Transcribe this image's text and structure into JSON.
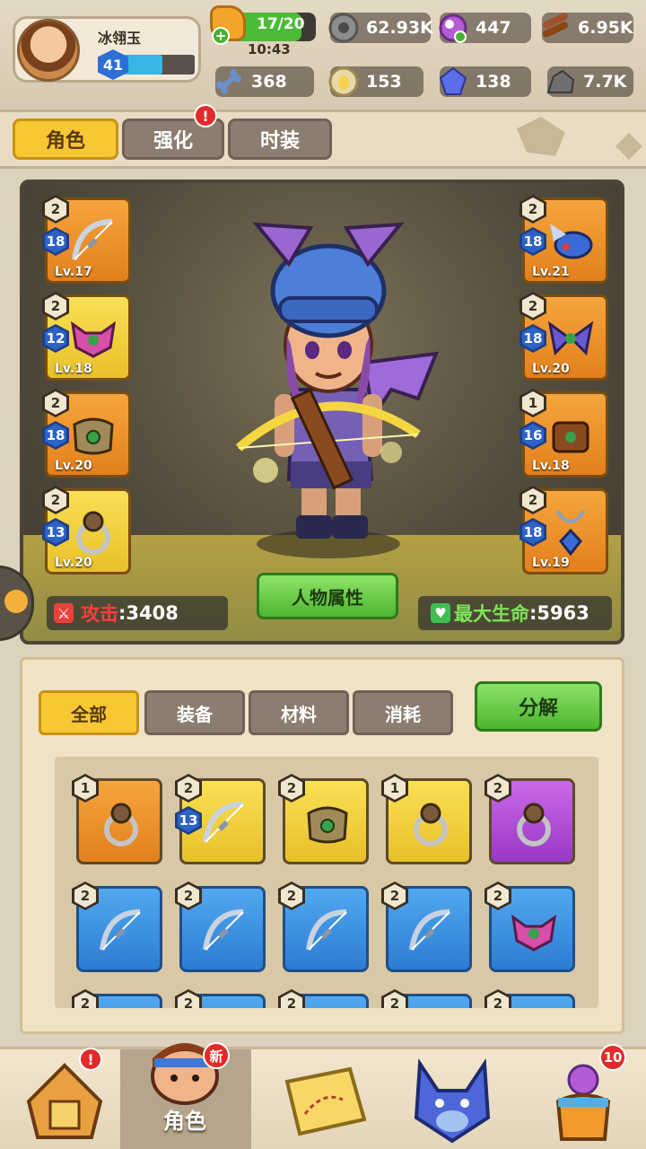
{
  "player": {
    "name": "冰翎玉",
    "level": "41",
    "xp_fraction": 0.55
  },
  "resources": {
    "stamina": "17/20",
    "stamina_fraction": 0.85,
    "stamina_timer": "10:43",
    "stone": "62.93K",
    "gem_purple": "447",
    "wood": "6.95K",
    "bone": "368",
    "egg_token": "153",
    "crystal": "138",
    "iron": "7.7K"
  },
  "tabs": [
    {
      "label": "角色",
      "active": true
    },
    {
      "label": "强化",
      "active": false,
      "alert": "!"
    },
    {
      "label": "时装",
      "active": false
    }
  ],
  "equipment_left": [
    {
      "grade": "2",
      "level_badge": "18",
      "lv": "Lv.17",
      "rarity": "orange",
      "icon": "crossbow-icon"
    },
    {
      "grade": "2",
      "level_badge": "12",
      "lv": "Lv.18",
      "rarity": "yellow",
      "icon": "bat-hat-icon"
    },
    {
      "grade": "2",
      "level_badge": "18",
      "lv": "Lv.20",
      "rarity": "orange",
      "icon": "armor-icon"
    },
    {
      "grade": "2",
      "level_badge": "13",
      "lv": "Lv.20",
      "rarity": "yellow",
      "icon": "ring-icon"
    }
  ],
  "equipment_right": [
    {
      "grade": "2",
      "level_badge": "18",
      "lv": "Lv.21",
      "rarity": "orange",
      "icon": "pet-icon"
    },
    {
      "grade": "2",
      "level_badge": "18",
      "lv": "Lv.20",
      "rarity": "orange",
      "icon": "wings-icon"
    },
    {
      "grade": "1",
      "level_badge": "16",
      "lv": "Lv.18",
      "rarity": "orange",
      "icon": "belt-icon"
    },
    {
      "grade": "2",
      "level_badge": "18",
      "lv": "Lv.19",
      "rarity": "orange",
      "icon": "amulet-icon"
    }
  ],
  "char_button": "人物属性",
  "stats": {
    "attack_label": "攻击",
    "attack_value": ":3408",
    "hp_label": "最大生命",
    "hp_value": ":5963"
  },
  "bag_tabs": [
    {
      "label": "全部",
      "active": true
    },
    {
      "label": "装备",
      "active": false
    },
    {
      "label": "材料",
      "active": false
    },
    {
      "label": "消耗",
      "active": false
    }
  ],
  "decompose_label": "分解",
  "inventory": [
    {
      "grade": "1",
      "level_badge": "",
      "rarity": "orange",
      "icon": "ring-icon"
    },
    {
      "grade": "2",
      "level_badge": "13",
      "rarity": "yellow",
      "icon": "bow-icon"
    },
    {
      "grade": "2",
      "level_badge": "",
      "rarity": "yellow",
      "icon": "armor-icon"
    },
    {
      "grade": "1",
      "level_badge": "",
      "rarity": "yellow",
      "icon": "ring-icon"
    },
    {
      "grade": "2",
      "level_badge": "",
      "rarity": "purple",
      "icon": "ring-icon"
    },
    {
      "grade": "2",
      "level_badge": "",
      "rarity": "blue",
      "icon": "bow-icon"
    },
    {
      "grade": "2",
      "level_badge": "",
      "rarity": "blue",
      "icon": "bow-icon"
    },
    {
      "grade": "2",
      "level_badge": "",
      "rarity": "blue",
      "icon": "bow-icon"
    },
    {
      "grade": "2",
      "level_badge": "",
      "rarity": "blue",
      "icon": "bow-icon"
    },
    {
      "grade": "2",
      "level_badge": "",
      "rarity": "blue",
      "icon": "bat-hat-icon"
    },
    {
      "grade": "2",
      "level_badge": "",
      "rarity": "blue",
      "icon": "bow-icon"
    },
    {
      "grade": "2",
      "level_badge": "",
      "rarity": "blue",
      "icon": "bow-icon"
    },
    {
      "grade": "2",
      "level_badge": "",
      "rarity": "blue",
      "icon": "bow-icon"
    },
    {
      "grade": "2",
      "level_badge": "",
      "rarity": "blue",
      "icon": "bow-icon"
    },
    {
      "grade": "2",
      "level_badge": "",
      "rarity": "blue",
      "icon": "bow-icon"
    }
  ],
  "nav": {
    "home_alert": "!",
    "role_label": "角色",
    "role_new": "新",
    "shop_count": "10"
  },
  "colors": {
    "accent_yellow": "#f7c734",
    "accent_green": "#4eb62e",
    "alert_red": "#e22a2a"
  }
}
